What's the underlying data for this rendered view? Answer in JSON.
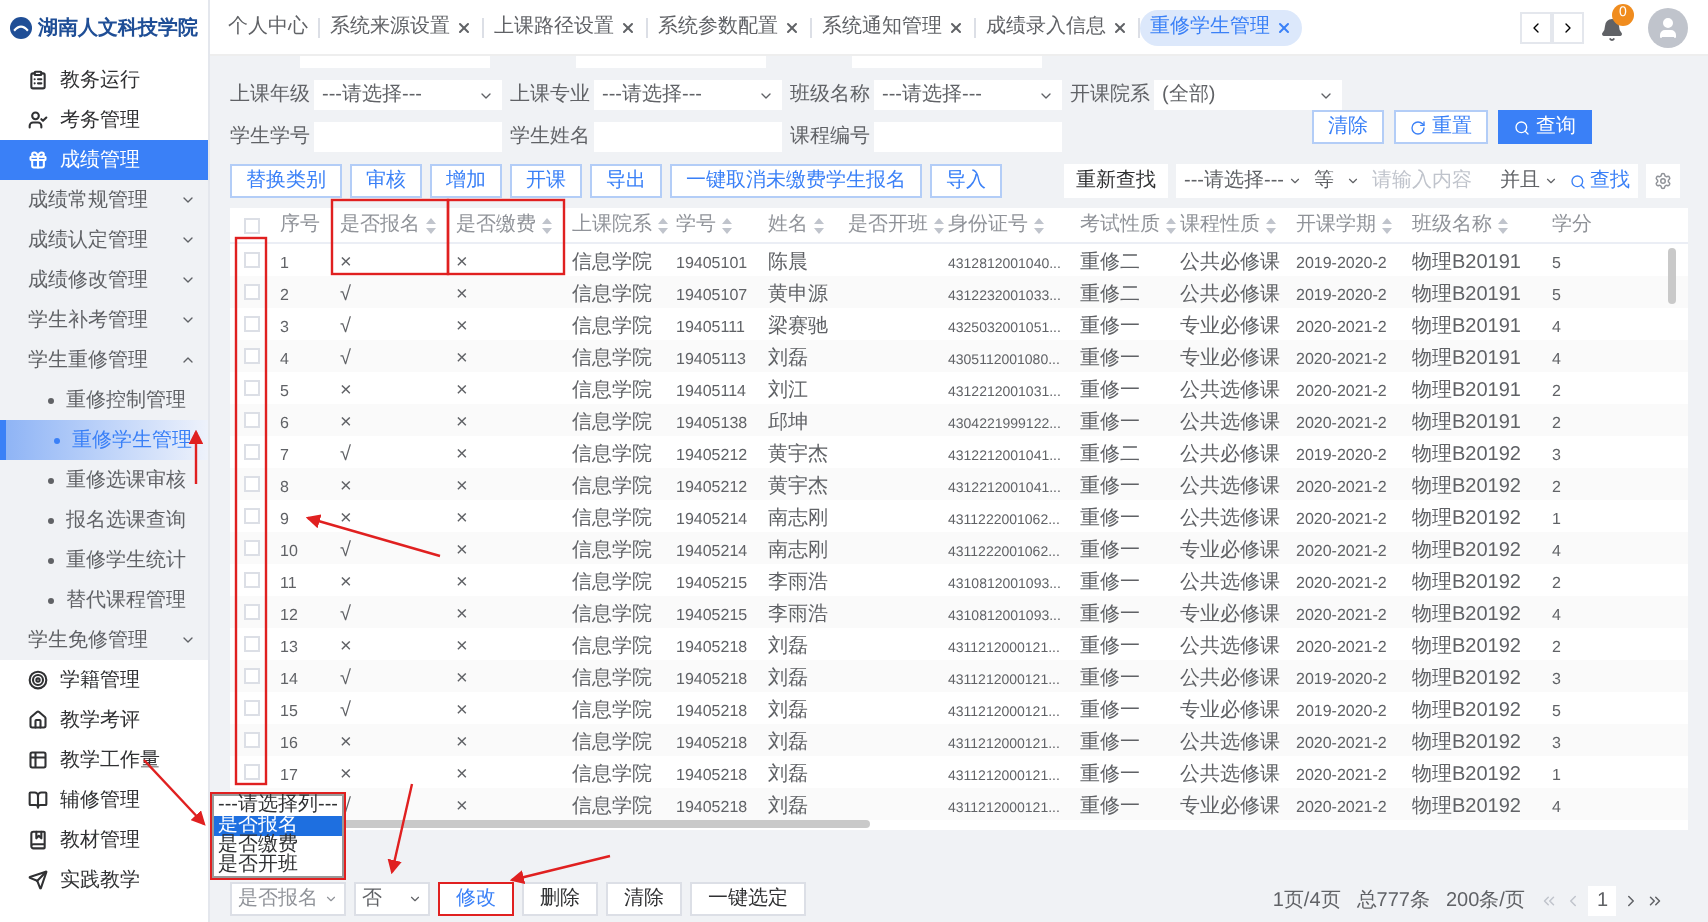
{
  "sidebar": {
    "logo": "湖南人文科技学院",
    "items": [
      {
        "label": "教务运行",
        "selected": false
      },
      {
        "label": "考务管理",
        "selected": false
      },
      {
        "label": "成绩管理",
        "selected": true,
        "children": [
          {
            "label": "成绩常规管理",
            "expanded": false
          },
          {
            "label": "成绩认定管理",
            "expanded": false
          },
          {
            "label": "成绩修改管理",
            "expanded": false
          },
          {
            "label": "学生补考管理",
            "expanded": false
          },
          {
            "label": "学生重修管理",
            "expanded": true,
            "children": [
              {
                "label": "重修控制管理",
                "selected": false
              },
              {
                "label": "重修学生管理",
                "selected": true
              },
              {
                "label": "重修选课审核",
                "selected": false
              },
              {
                "label": "报名选课查询",
                "selected": false
              },
              {
                "label": "重修学生统计",
                "selected": false
              },
              {
                "label": "替代课程管理",
                "selected": false
              }
            ]
          },
          {
            "label": "学生免修管理",
            "expanded": false
          }
        ]
      },
      {
        "label": "学籍管理",
        "selected": false
      },
      {
        "label": "教学考评",
        "selected": false
      },
      {
        "label": "教学工作量",
        "selected": false
      },
      {
        "label": "辅修管理",
        "selected": false
      },
      {
        "label": "教材管理",
        "selected": false
      },
      {
        "label": "实践教学",
        "selected": false
      }
    ]
  },
  "tabs": [
    {
      "label": "个人中心",
      "closable": false,
      "selected": false
    },
    {
      "label": "系统来源设置",
      "closable": true,
      "selected": false
    },
    {
      "label": "上课路径设置",
      "closable": true,
      "selected": false
    },
    {
      "label": "系统参数配置",
      "closable": true,
      "selected": false
    },
    {
      "label": "系统通知管理",
      "closable": true,
      "selected": false
    },
    {
      "label": "成绩录入信息",
      "closable": true,
      "selected": false
    },
    {
      "label": "重修学生管理",
      "closable": true,
      "selected": true
    }
  ],
  "header": {
    "notifications": "0"
  },
  "filters": [
    [
      {
        "label": "上课年级",
        "kind": "select",
        "value": "---请选择---"
      },
      {
        "label": "上课专业",
        "kind": "select",
        "value": "---请选择---"
      },
      {
        "label": "班级名称",
        "kind": "select",
        "value": "---请选择---"
      },
      {
        "label": "开课院系",
        "kind": "select",
        "value": "(全部)"
      }
    ],
    [
      {
        "label": "学生学号",
        "kind": "input"
      },
      {
        "label": "学生姓名",
        "kind": "input"
      },
      {
        "label": "课程编号",
        "kind": "input"
      }
    ]
  ],
  "filter_buttons": [
    {
      "label": "清除",
      "kind": "plain"
    },
    {
      "label": "重置",
      "kind": "reset"
    },
    {
      "label": "查询",
      "kind": "primary"
    }
  ],
  "actions": [
    "替换类别",
    "审核",
    "增加",
    "开课",
    "导出",
    "一键取消未缴费学生报名",
    "导入"
  ],
  "search": {
    "button": "重新查找",
    "field": "---请选择---",
    "operator": "等",
    "placeholder": "请输入内容",
    "join": "并且",
    "find": "查找"
  },
  "table": {
    "all_checked": false,
    "columns": [
      "序号",
      "是否报名",
      "是否缴费",
      "上课院系",
      "学号",
      "姓名",
      "是否开班",
      "身份证号",
      "考试性质",
      "课程性质",
      "开课学期",
      "班级名称",
      "学分"
    ],
    "rows": [
      {
        "checked": false,
        "cells": [
          "1",
          "×",
          "×",
          "信息学院",
          "19405101",
          "陈晨",
          "",
          "4312812001040...",
          "重修二",
          "公共必修课",
          "2019-2020-2",
          "物理B20191",
          "5"
        ]
      },
      {
        "checked": false,
        "cells": [
          "2",
          "√",
          "×",
          "信息学院",
          "19405107",
          "黄申源",
          "",
          "4312232001033...",
          "重修二",
          "公共必修课",
          "2019-2020-2",
          "物理B20191",
          "5"
        ]
      },
      {
        "checked": false,
        "cells": [
          "3",
          "√",
          "×",
          "信息学院",
          "19405111",
          "梁赛驰",
          "",
          "4325032001051...",
          "重修一",
          "专业必修课",
          "2020-2021-2",
          "物理B20191",
          "4"
        ]
      },
      {
        "checked": false,
        "cells": [
          "4",
          "√",
          "×",
          "信息学院",
          "19405113",
          "刘磊",
          "",
          "4305112001080...",
          "重修一",
          "专业必修课",
          "2020-2021-2",
          "物理B20191",
          "4"
        ]
      },
      {
        "checked": false,
        "cells": [
          "5",
          "×",
          "×",
          "信息学院",
          "19405114",
          "刘江",
          "",
          "4312212001031...",
          "重修一",
          "公共选修课",
          "2020-2021-2",
          "物理B20191",
          "2"
        ]
      },
      {
        "checked": false,
        "cells": [
          "6",
          "×",
          "×",
          "信息学院",
          "19405138",
          "邱坤",
          "",
          "4304221999122...",
          "重修一",
          "公共选修课",
          "2020-2021-2",
          "物理B20191",
          "2"
        ]
      },
      {
        "checked": false,
        "cells": [
          "7",
          "√",
          "×",
          "信息学院",
          "19405212",
          "黄宇杰",
          "",
          "4312212001041...",
          "重修二",
          "公共必修课",
          "2019-2020-2",
          "物理B20192",
          "3"
        ]
      },
      {
        "checked": false,
        "cells": [
          "8",
          "×",
          "×",
          "信息学院",
          "19405212",
          "黄宇杰",
          "",
          "4312212001041...",
          "重修一",
          "公共选修课",
          "2020-2021-2",
          "物理B20192",
          "2"
        ]
      },
      {
        "checked": false,
        "cells": [
          "9",
          "×",
          "×",
          "信息学院",
          "19405214",
          "南志刚",
          "",
          "4311222001062...",
          "重修一",
          "公共选修课",
          "2020-2021-2",
          "物理B20192",
          "1"
        ]
      },
      {
        "checked": false,
        "cells": [
          "10",
          "√",
          "×",
          "信息学院",
          "19405214",
          "南志刚",
          "",
          "4311222001062...",
          "重修一",
          "专业必修课",
          "2020-2021-2",
          "物理B20192",
          "4"
        ]
      },
      {
        "checked": false,
        "cells": [
          "11",
          "×",
          "×",
          "信息学院",
          "19405215",
          "李雨浩",
          "",
          "4310812001093...",
          "重修一",
          "公共选修课",
          "2020-2021-2",
          "物理B20192",
          "2"
        ]
      },
      {
        "checked": false,
        "cells": [
          "12",
          "√",
          "×",
          "信息学院",
          "19405215",
          "李雨浩",
          "",
          "4310812001093...",
          "重修一",
          "专业必修课",
          "2020-2021-2",
          "物理B20192",
          "4"
        ]
      },
      {
        "checked": false,
        "cells": [
          "13",
          "×",
          "×",
          "信息学院",
          "19405218",
          "刘磊",
          "",
          "4311212000121...",
          "重修一",
          "公共选修课",
          "2020-2021-2",
          "物理B20192",
          "2"
        ]
      },
      {
        "checked": false,
        "cells": [
          "14",
          "√",
          "×",
          "信息学院",
          "19405218",
          "刘磊",
          "",
          "4311212000121...",
          "重修一",
          "公共必修课",
          "2019-2020-2",
          "物理B20192",
          "3"
        ]
      },
      {
        "checked": false,
        "cells": [
          "15",
          "√",
          "×",
          "信息学院",
          "19405218",
          "刘磊",
          "",
          "4311212000121...",
          "重修一",
          "专业必修课",
          "2019-2020-2",
          "物理B20192",
          "5"
        ]
      },
      {
        "checked": false,
        "cells": [
          "16",
          "×",
          "×",
          "信息学院",
          "19405218",
          "刘磊",
          "",
          "4311212000121...",
          "重修一",
          "公共选修课",
          "2020-2021-2",
          "物理B20192",
          "3"
        ]
      },
      {
        "checked": false,
        "cells": [
          "17",
          "×",
          "×",
          "信息学院",
          "19405218",
          "刘磊",
          "",
          "4311212000121...",
          "重修一",
          "公共选修课",
          "2020-2021-2",
          "物理B20192",
          "1"
        ]
      },
      {
        "cells": [
          "",
          "√",
          "×",
          "信息学院",
          "19405218",
          "刘磊",
          "",
          "4311212000121...",
          "重修一",
          "专业必修课",
          "2020-2021-2",
          "物理B20192",
          "4"
        ]
      }
    ]
  },
  "column_menu": {
    "options": [
      {
        "label": "---请选择列---",
        "selected": false
      },
      {
        "label": "是否报名",
        "selected": true
      },
      {
        "label": "是否缴费",
        "selected": false
      },
      {
        "label": "是否开班",
        "selected": false
      }
    ]
  },
  "bulk": {
    "column": "是否报名",
    "value": "否",
    "buttons": [
      {
        "label": "修改",
        "highlighted": true
      },
      {
        "label": "删除",
        "highlighted": false
      },
      {
        "label": "清除",
        "highlighted": false
      },
      {
        "label": "一键选定",
        "highlighted": false
      }
    ]
  },
  "pagination": {
    "pages": "1页/4页",
    "total": "总777条",
    "per_page": "200条/页",
    "current": "1"
  }
}
